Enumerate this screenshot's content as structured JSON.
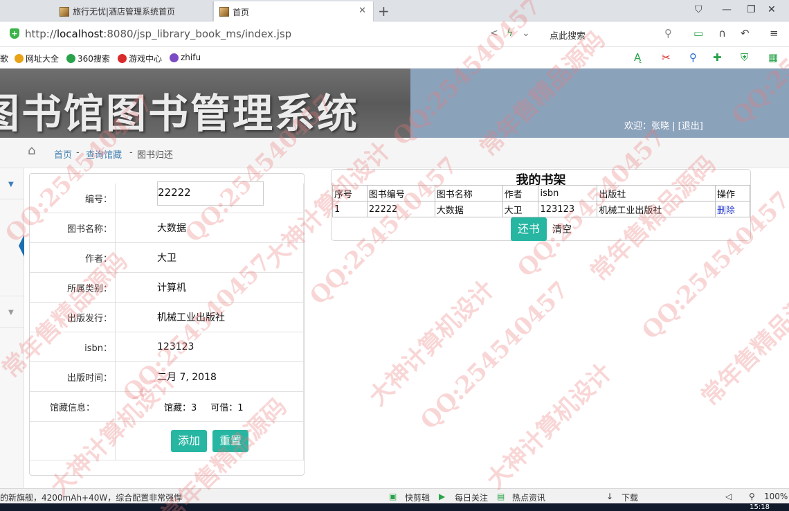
{
  "browser": {
    "tabs": [
      {
        "title": "旅行无忧|酒店管理系统首页",
        "active": false
      },
      {
        "title": "首页",
        "active": true
      }
    ],
    "url_prefix": "http://",
    "url_host": "localhost",
    "url_rest": ":8080/jsp_library_book_ms/index.jsp",
    "search_placeholder": "点此搜索",
    "bookmarks": [
      {
        "label": "歌",
        "color": "#c0392b"
      },
      {
        "label": "网址大全",
        "color": "#e8a317"
      },
      {
        "label": "360搜索",
        "color": "#29a34a"
      },
      {
        "label": "游戏中心",
        "color": "#d92b2b"
      },
      {
        "label": "zhifu",
        "color": "#7a4bc4"
      }
    ]
  },
  "header": {
    "system_title": "图书馆图书管理系统",
    "welcome_label": "欢迎：张晓",
    "logout_label": "[退出]"
  },
  "breadcrumb": {
    "home": "首页",
    "level2": "查询馆藏",
    "current": "图书归还",
    "sep": "-"
  },
  "form": {
    "fields": [
      {
        "label": "编号：",
        "value": "22222",
        "kind": "input"
      },
      {
        "label": "图书名称：",
        "value": "大数据"
      },
      {
        "label": "作者：",
        "value": "大卫"
      },
      {
        "label": "所属类别：",
        "value": "计算机"
      },
      {
        "label": "出版发行：",
        "value": "机械工业出版社"
      },
      {
        "label": "isbn：",
        "value": "123123"
      },
      {
        "label": "出版时间：",
        "value": "二月 7, 2018"
      }
    ],
    "holdings_label": "馆藏信息：",
    "holdings_total": "馆藏：3",
    "holdings_available": "可借：1",
    "add_button": "添加",
    "reset_button": "重置"
  },
  "shelf": {
    "title": "我的书架",
    "columns": [
      "序号",
      "图书编号",
      "图书名称",
      "作者",
      "isbn",
      "出版社",
      "操作"
    ],
    "rows": [
      [
        "1",
        "22222",
        "大数据",
        "大卫",
        "123123",
        "机械工业出版社",
        "删除"
      ]
    ],
    "return_button": "还书",
    "clear_link": "清空"
  },
  "statusbar": {
    "ad_text": "的新旗舰，4200mAh+40W，综合配置非常强悍",
    "items": [
      "快剪辑",
      "每日关注",
      "热点资讯",
      "下载"
    ],
    "zoom": "100%",
    "time": "15:18"
  },
  "watermark": {
    "texts": [
      "QQ:254540457",
      "常年售精品源码",
      "大神计算机设计"
    ]
  }
}
